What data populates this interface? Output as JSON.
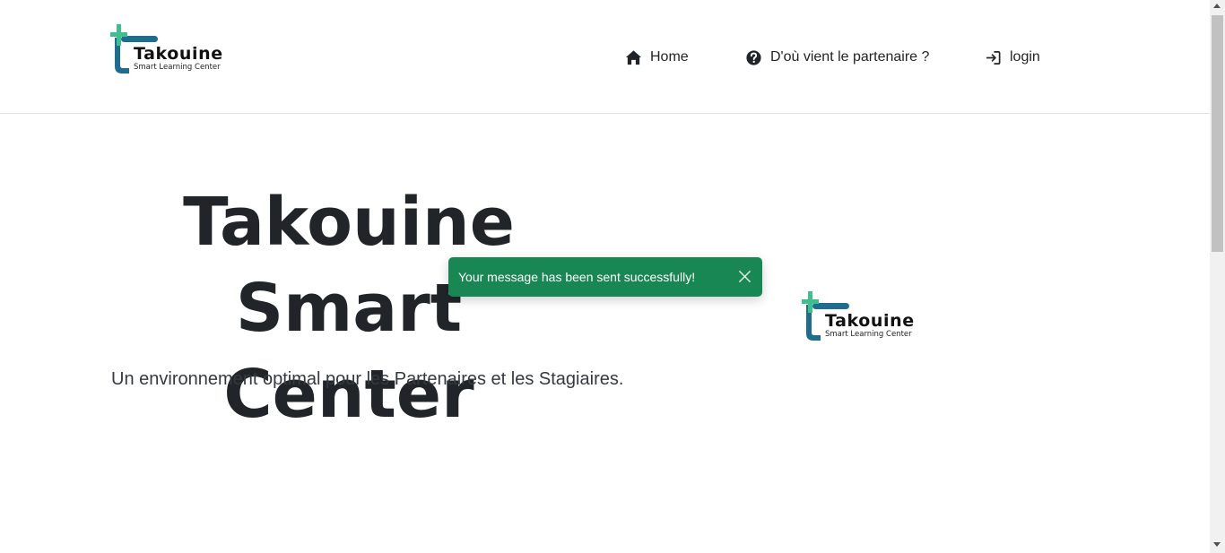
{
  "header": {
    "logo": {
      "title": "Takouine",
      "subtitle": "Smart Learning Center"
    },
    "nav": [
      {
        "label": "Home",
        "icon": "home-icon"
      },
      {
        "label": "D'où vient le partenaire ?",
        "icon": "question-circle-icon"
      },
      {
        "label": "login",
        "icon": "login-icon"
      }
    ]
  },
  "hero": {
    "title_line1": "Takouine",
    "title_line2": "Smart Center",
    "lead": "Un environnement optimal pour les Partenaires et les Stagiaires.",
    "logo": {
      "title": "Takouine",
      "subtitle": "Smart Learning Center"
    }
  },
  "toast": {
    "message": "Your message has been sent successfully!",
    "color": "#198754"
  },
  "colors": {
    "logo_teal": "#1f6d8c",
    "logo_green": "#3fbf8f",
    "text": "#212529"
  }
}
